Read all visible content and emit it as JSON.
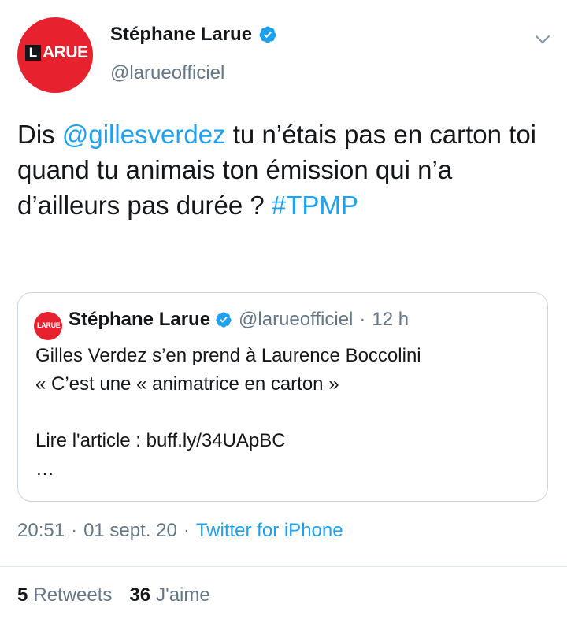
{
  "author": {
    "name": "Stéphane Larue",
    "handle": "@larueofficiel",
    "avatar_logo_letter": "L",
    "avatar_logo_rest": "ARUE"
  },
  "tweet": {
    "text_part1": "Dis ",
    "mention": "@gillesverdez",
    "text_part2": " tu n’étais pas en carton toi quand tu animais ton émission qui n’a d’ailleurs pas durée ? ",
    "hashtag": "#TPMP"
  },
  "quoted_tweet": {
    "name": "Stéphane Larue",
    "handle": "@larueofficiel",
    "separator": "·",
    "time": "12 h",
    "avatar_text": "LARUE",
    "lines": [
      "Gilles Verdez s’en prend à Laurence Boccolini",
      "« C’est une « animatrice en carton »",
      "",
      "Lire l'article : buff.ly/34UApBC",
      "…"
    ]
  },
  "meta": {
    "time": "20:51",
    "sep1": "·",
    "date": "01 sept. 20",
    "sep2": "·",
    "source": "Twitter for iPhone"
  },
  "stats": {
    "retweets_count": "5",
    "retweets_label": "Retweets",
    "likes_count": "36",
    "likes_label": "J'aime"
  },
  "colors": {
    "accent": "#1da1f2",
    "avatar_red": "#e8212e",
    "secondary_text": "#657786"
  },
  "icons": {
    "verified": "verified-badge-icon",
    "menu": "chevron-down-icon"
  }
}
